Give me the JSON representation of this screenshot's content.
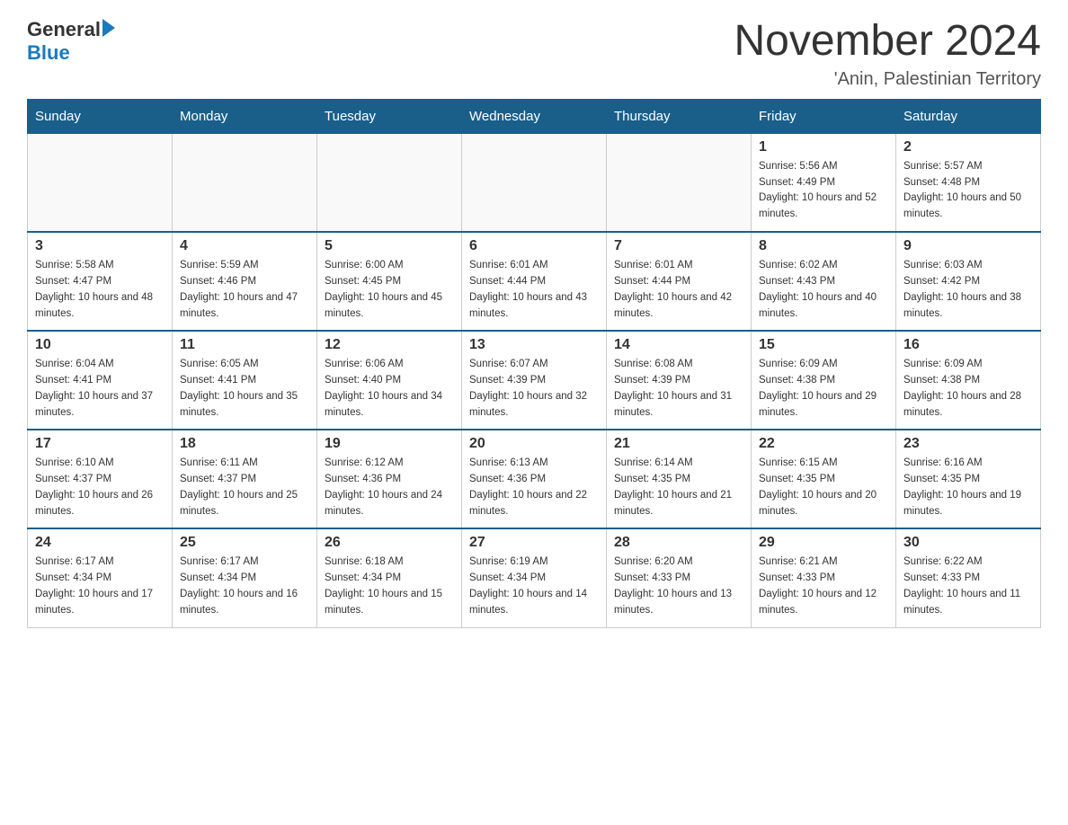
{
  "header": {
    "logo_general": "General",
    "logo_blue": "Blue",
    "month_title": "November 2024",
    "location": "'Anin, Palestinian Territory"
  },
  "weekdays": [
    "Sunday",
    "Monday",
    "Tuesday",
    "Wednesday",
    "Thursday",
    "Friday",
    "Saturday"
  ],
  "weeks": [
    [
      {
        "day": "",
        "sunrise": "",
        "sunset": "",
        "daylight": ""
      },
      {
        "day": "",
        "sunrise": "",
        "sunset": "",
        "daylight": ""
      },
      {
        "day": "",
        "sunrise": "",
        "sunset": "",
        "daylight": ""
      },
      {
        "day": "",
        "sunrise": "",
        "sunset": "",
        "daylight": ""
      },
      {
        "day": "",
        "sunrise": "",
        "sunset": "",
        "daylight": ""
      },
      {
        "day": "1",
        "sunrise": "Sunrise: 5:56 AM",
        "sunset": "Sunset: 4:49 PM",
        "daylight": "Daylight: 10 hours and 52 minutes."
      },
      {
        "day": "2",
        "sunrise": "Sunrise: 5:57 AM",
        "sunset": "Sunset: 4:48 PM",
        "daylight": "Daylight: 10 hours and 50 minutes."
      }
    ],
    [
      {
        "day": "3",
        "sunrise": "Sunrise: 5:58 AM",
        "sunset": "Sunset: 4:47 PM",
        "daylight": "Daylight: 10 hours and 48 minutes."
      },
      {
        "day": "4",
        "sunrise": "Sunrise: 5:59 AM",
        "sunset": "Sunset: 4:46 PM",
        "daylight": "Daylight: 10 hours and 47 minutes."
      },
      {
        "day": "5",
        "sunrise": "Sunrise: 6:00 AM",
        "sunset": "Sunset: 4:45 PM",
        "daylight": "Daylight: 10 hours and 45 minutes."
      },
      {
        "day": "6",
        "sunrise": "Sunrise: 6:01 AM",
        "sunset": "Sunset: 4:44 PM",
        "daylight": "Daylight: 10 hours and 43 minutes."
      },
      {
        "day": "7",
        "sunrise": "Sunrise: 6:01 AM",
        "sunset": "Sunset: 4:44 PM",
        "daylight": "Daylight: 10 hours and 42 minutes."
      },
      {
        "day": "8",
        "sunrise": "Sunrise: 6:02 AM",
        "sunset": "Sunset: 4:43 PM",
        "daylight": "Daylight: 10 hours and 40 minutes."
      },
      {
        "day": "9",
        "sunrise": "Sunrise: 6:03 AM",
        "sunset": "Sunset: 4:42 PM",
        "daylight": "Daylight: 10 hours and 38 minutes."
      }
    ],
    [
      {
        "day": "10",
        "sunrise": "Sunrise: 6:04 AM",
        "sunset": "Sunset: 4:41 PM",
        "daylight": "Daylight: 10 hours and 37 minutes."
      },
      {
        "day": "11",
        "sunrise": "Sunrise: 6:05 AM",
        "sunset": "Sunset: 4:41 PM",
        "daylight": "Daylight: 10 hours and 35 minutes."
      },
      {
        "day": "12",
        "sunrise": "Sunrise: 6:06 AM",
        "sunset": "Sunset: 4:40 PM",
        "daylight": "Daylight: 10 hours and 34 minutes."
      },
      {
        "day": "13",
        "sunrise": "Sunrise: 6:07 AM",
        "sunset": "Sunset: 4:39 PM",
        "daylight": "Daylight: 10 hours and 32 minutes."
      },
      {
        "day": "14",
        "sunrise": "Sunrise: 6:08 AM",
        "sunset": "Sunset: 4:39 PM",
        "daylight": "Daylight: 10 hours and 31 minutes."
      },
      {
        "day": "15",
        "sunrise": "Sunrise: 6:09 AM",
        "sunset": "Sunset: 4:38 PM",
        "daylight": "Daylight: 10 hours and 29 minutes."
      },
      {
        "day": "16",
        "sunrise": "Sunrise: 6:09 AM",
        "sunset": "Sunset: 4:38 PM",
        "daylight": "Daylight: 10 hours and 28 minutes."
      }
    ],
    [
      {
        "day": "17",
        "sunrise": "Sunrise: 6:10 AM",
        "sunset": "Sunset: 4:37 PM",
        "daylight": "Daylight: 10 hours and 26 minutes."
      },
      {
        "day": "18",
        "sunrise": "Sunrise: 6:11 AM",
        "sunset": "Sunset: 4:37 PM",
        "daylight": "Daylight: 10 hours and 25 minutes."
      },
      {
        "day": "19",
        "sunrise": "Sunrise: 6:12 AM",
        "sunset": "Sunset: 4:36 PM",
        "daylight": "Daylight: 10 hours and 24 minutes."
      },
      {
        "day": "20",
        "sunrise": "Sunrise: 6:13 AM",
        "sunset": "Sunset: 4:36 PM",
        "daylight": "Daylight: 10 hours and 22 minutes."
      },
      {
        "day": "21",
        "sunrise": "Sunrise: 6:14 AM",
        "sunset": "Sunset: 4:35 PM",
        "daylight": "Daylight: 10 hours and 21 minutes."
      },
      {
        "day": "22",
        "sunrise": "Sunrise: 6:15 AM",
        "sunset": "Sunset: 4:35 PM",
        "daylight": "Daylight: 10 hours and 20 minutes."
      },
      {
        "day": "23",
        "sunrise": "Sunrise: 6:16 AM",
        "sunset": "Sunset: 4:35 PM",
        "daylight": "Daylight: 10 hours and 19 minutes."
      }
    ],
    [
      {
        "day": "24",
        "sunrise": "Sunrise: 6:17 AM",
        "sunset": "Sunset: 4:34 PM",
        "daylight": "Daylight: 10 hours and 17 minutes."
      },
      {
        "day": "25",
        "sunrise": "Sunrise: 6:17 AM",
        "sunset": "Sunset: 4:34 PM",
        "daylight": "Daylight: 10 hours and 16 minutes."
      },
      {
        "day": "26",
        "sunrise": "Sunrise: 6:18 AM",
        "sunset": "Sunset: 4:34 PM",
        "daylight": "Daylight: 10 hours and 15 minutes."
      },
      {
        "day": "27",
        "sunrise": "Sunrise: 6:19 AM",
        "sunset": "Sunset: 4:34 PM",
        "daylight": "Daylight: 10 hours and 14 minutes."
      },
      {
        "day": "28",
        "sunrise": "Sunrise: 6:20 AM",
        "sunset": "Sunset: 4:33 PM",
        "daylight": "Daylight: 10 hours and 13 minutes."
      },
      {
        "day": "29",
        "sunrise": "Sunrise: 6:21 AM",
        "sunset": "Sunset: 4:33 PM",
        "daylight": "Daylight: 10 hours and 12 minutes."
      },
      {
        "day": "30",
        "sunrise": "Sunrise: 6:22 AM",
        "sunset": "Sunset: 4:33 PM",
        "daylight": "Daylight: 10 hours and 11 minutes."
      }
    ]
  ]
}
